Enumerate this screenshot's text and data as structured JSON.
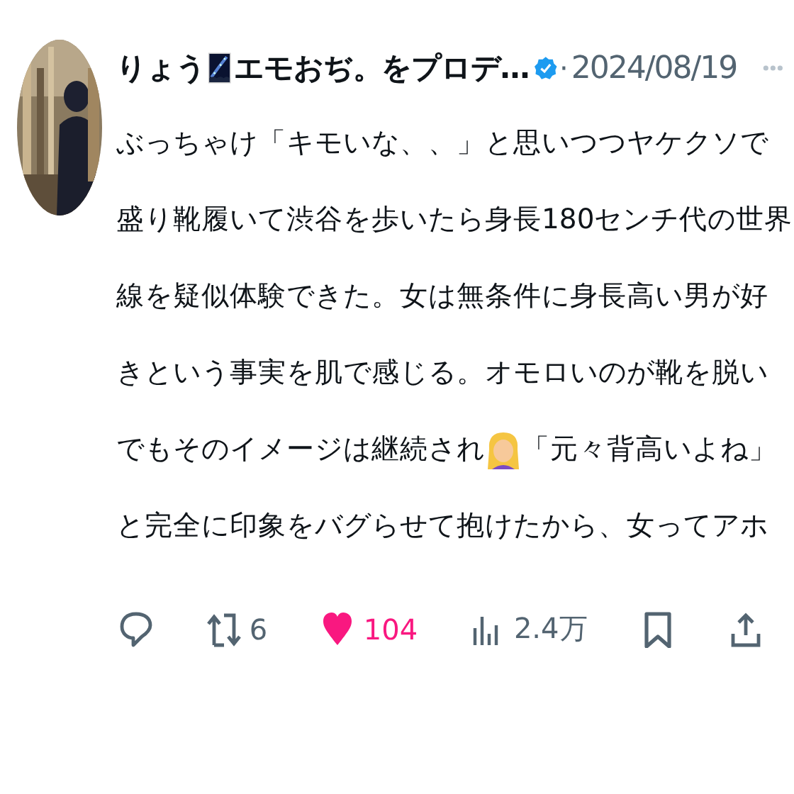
{
  "author": {
    "name_parts": [
      "りょう",
      "エモおぢ。をプロデ…"
    ],
    "verified": true
  },
  "separator": "·",
  "date": "2024/08/19",
  "body_lines": [
    [
      {
        "kind": "text",
        "text": "ぶっちゃけ「キモいな、、」と思いつつヤケクソで"
      }
    ],
    [
      {
        "kind": "text",
        "text": "盛り靴履いて渋谷を歩いたら身長180センチ代の世界"
      }
    ],
    [
      {
        "kind": "text",
        "text": "線を疑似体験できた。女は無条件に身長高い男が好"
      }
    ],
    [
      {
        "kind": "text",
        "text": "きという事実を肌で感じる。オモロいのが靴を脱い"
      }
    ],
    [
      {
        "kind": "text",
        "text": "でもそのイメージは継続され"
      },
      {
        "kind": "emoji"
      },
      {
        "kind": "text",
        "text": "「元々背高いよね」"
      }
    ],
    [
      {
        "kind": "text",
        "text": "と完全に印象をバグらせて抱けたから、女ってアホ"
      }
    ]
  ],
  "actions": [
    {
      "kind": "reply"
    },
    {
      "kind": "retweet",
      "count": "6"
    },
    {
      "kind": "like",
      "count": "104",
      "on": true
    },
    {
      "kind": "views",
      "count": "2.4万"
    },
    {
      "kind": "bookmark"
    },
    {
      "kind": "share"
    }
  ]
}
